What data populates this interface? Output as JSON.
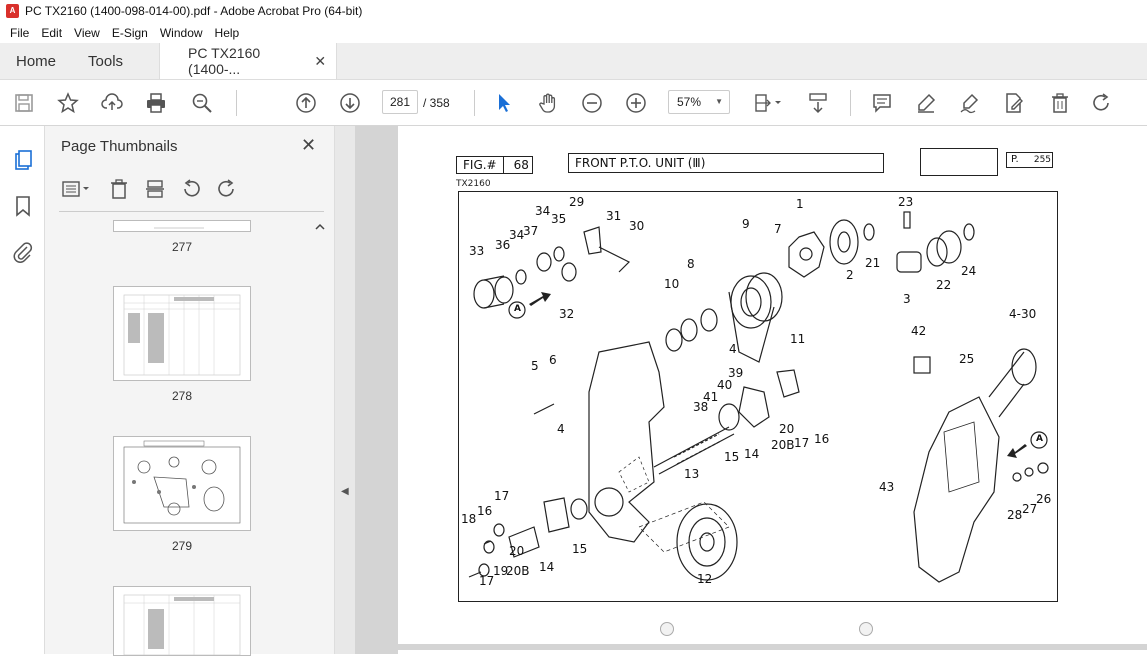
{
  "window": {
    "title": "PC TX2160 (1400-098-014-00).pdf - Adobe Acrobat Pro (64-bit)"
  },
  "menu": [
    "File",
    "Edit",
    "View",
    "E-Sign",
    "Window",
    "Help"
  ],
  "tabs": {
    "home": "Home",
    "tools": "Tools",
    "document": "PC TX2160 (1400-..."
  },
  "nav": {
    "current_page": "281",
    "total_pages": "/ 358",
    "zoom": "57%"
  },
  "thumbnails": {
    "title": "Page Thumbnails",
    "pages": [
      "277",
      "278",
      "279"
    ]
  },
  "page": {
    "fig_label": "FIG.#",
    "fig_number": "68",
    "title": "FRONT P.T.O. UNIT (Ⅲ)",
    "page_label": "P.",
    "page_number": "255",
    "model": "TX2160",
    "callouts": [
      "1",
      "2",
      "3",
      "4",
      "4-30",
      "5",
      "6",
      "7",
      "8",
      "9",
      "10",
      "11",
      "12",
      "13",
      "14",
      "15",
      "16",
      "17",
      "18",
      "19",
      "20",
      "20B",
      "21",
      "22",
      "23",
      "24",
      "25",
      "26",
      "27",
      "28",
      "29",
      "30",
      "31",
      "32",
      "33",
      "34",
      "35",
      "36",
      "37",
      "38",
      "39",
      "40",
      "41",
      "42",
      "43",
      "A"
    ]
  }
}
